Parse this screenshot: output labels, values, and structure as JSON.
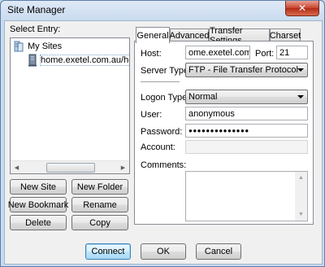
{
  "window": {
    "title": "Site Manager",
    "close_glyph": "✕"
  },
  "left": {
    "select_entry_label": "Select Entry:",
    "tree": [
      {
        "label": "My Sites",
        "icon": "sites-folder-icon"
      },
      {
        "label": "home.exetel.com.au/helicopter",
        "icon": "server-icon"
      }
    ],
    "buttons": {
      "new_site": "New Site",
      "new_folder": "New Folder",
      "new_bookmark": "New Bookmark",
      "rename": "Rename",
      "delete": "Delete",
      "copy": "Copy"
    }
  },
  "tabs": [
    "General",
    "Advanced",
    "Transfer Settings",
    "Charset"
  ],
  "general": {
    "host_label": "Host:",
    "host_value": "ome.exetel.com.au",
    "port_label": "Port:",
    "port_value": "21",
    "server_type_label": "Server Type:",
    "server_type_value": "FTP - File Transfer Protocol",
    "logon_type_label": "Logon Type:",
    "logon_type_value": "Normal",
    "user_label": "User:",
    "user_value": "anonymous",
    "password_label": "Password:",
    "password_value": "●●●●●●●●●●●●●●",
    "account_label": "Account:",
    "account_value": "",
    "comments_label": "Comments:",
    "comments_value": ""
  },
  "footer": {
    "connect": "Connect",
    "ok": "OK",
    "cancel": "Cancel"
  },
  "colors": {
    "accent": "#3c7fb1",
    "title_close": "#c7432f"
  }
}
